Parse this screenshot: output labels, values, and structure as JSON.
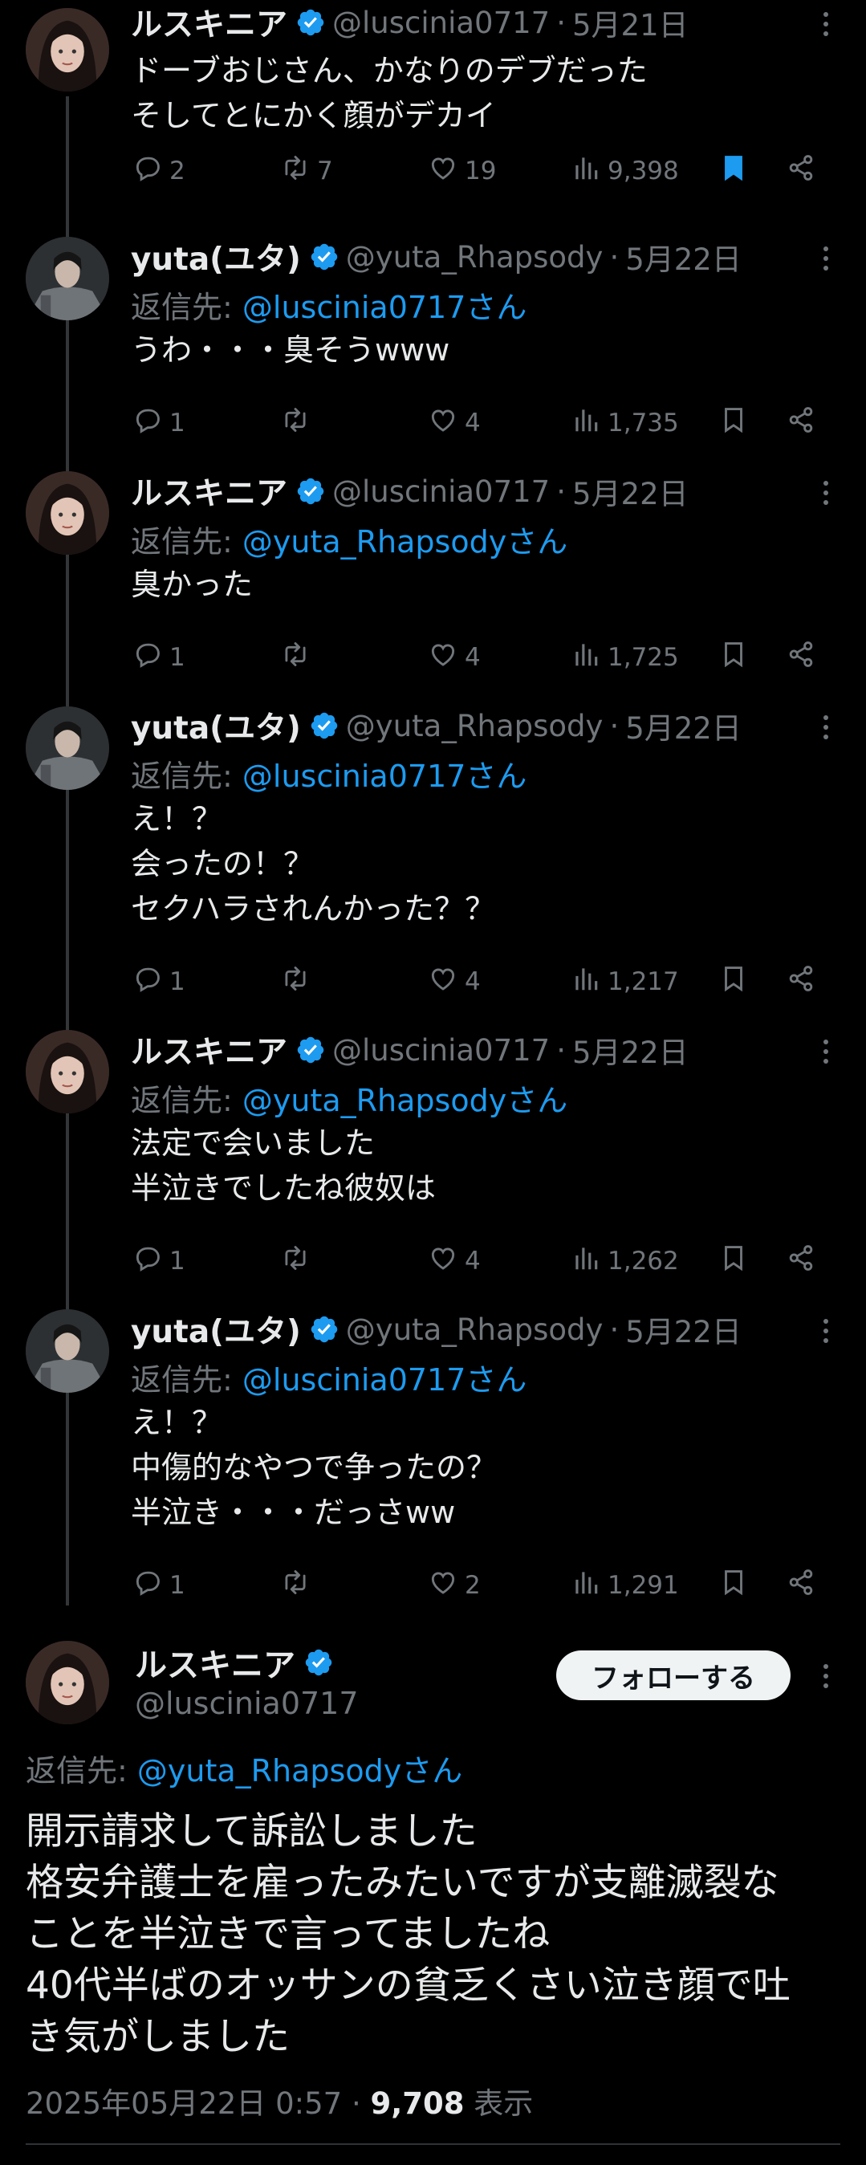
{
  "colors": {
    "accent": "#1d9bf0",
    "muted": "#71767b",
    "text": "#e7e9ea",
    "background": "#000000"
  },
  "tweets": [
    {
      "author": "ルスキニア",
      "handle": "@luscinia0717",
      "sep": "·",
      "date": "5月21日",
      "reply_prefix": "",
      "reply_mention": "",
      "lines": [
        "ドーブおじさん、かなりのデブだった",
        "そしてとにかく顔がデカイ"
      ],
      "replies": "2",
      "retweets": "7",
      "likes": "19",
      "views": "9,398",
      "bookmarked": true
    },
    {
      "author": "yuta(ユタ)",
      "handle": "@yuta_Rhapsody",
      "sep": "·",
      "date": "5月22日",
      "reply_prefix": "返信先: ",
      "reply_mention": "@luscinia0717さん",
      "lines": [
        "うわ・・・臭そうwww"
      ],
      "replies": "1",
      "retweets": "",
      "likes": "4",
      "views": "1,735",
      "bookmarked": false
    },
    {
      "author": "ルスキニア",
      "handle": "@luscinia0717",
      "sep": "·",
      "date": "5月22日",
      "reply_prefix": "返信先: ",
      "reply_mention": "@yuta_Rhapsodyさん",
      "lines": [
        "臭かった"
      ],
      "replies": "1",
      "retweets": "",
      "likes": "4",
      "views": "1,725",
      "bookmarked": false
    },
    {
      "author": "yuta(ユタ)",
      "handle": "@yuta_Rhapsody",
      "sep": "·",
      "date": "5月22日",
      "reply_prefix": "返信先: ",
      "reply_mention": "@luscinia0717さん",
      "lines": [
        "え！？",
        "会ったの！？",
        "セクハラされんかった？？"
      ],
      "replies": "1",
      "retweets": "",
      "likes": "4",
      "views": "1,217",
      "bookmarked": false
    },
    {
      "author": "ルスキニア",
      "handle": "@luscinia0717",
      "sep": "·",
      "date": "5月22日",
      "reply_prefix": "返信先: ",
      "reply_mention": "@yuta_Rhapsodyさん",
      "lines": [
        "法定で会いました",
        "半泣きでしたね彼奴は"
      ],
      "replies": "1",
      "retweets": "",
      "likes": "4",
      "views": "1,262",
      "bookmarked": false
    },
    {
      "author": "yuta(ユタ)",
      "handle": "@yuta_Rhapsody",
      "sep": "·",
      "date": "5月22日",
      "reply_prefix": "返信先: ",
      "reply_mention": "@luscinia0717さん",
      "lines": [
        "え！？",
        "中傷的なやつで争ったの？",
        "半泣き・・・だっさww"
      ],
      "replies": "1",
      "retweets": "",
      "likes": "2",
      "views": "1,291",
      "bookmarked": false
    }
  ],
  "main": {
    "author": "ルスキニア",
    "handle": "@luscinia0717",
    "follow_label": "フォローする",
    "reply_prefix": "返信先: ",
    "reply_mention": "@yuta_Rhapsodyさん",
    "lines": [
      "開示請求して訴訟しました",
      "格安弁護士を雇ったみたいですが支離滅裂な",
      "ことを半泣きで言ってましたね",
      "40代半ばのオッサンの貧乏くさい泣き顔で吐",
      "き気がしました"
    ],
    "timestamp": "2025年05月22日 0:57",
    "sep": " · ",
    "views": "9,708",
    "views_label": " 表示"
  },
  "icons": [
    "reply-icon",
    "retweet-icon",
    "like-icon",
    "views-icon",
    "bookmark-icon",
    "share-icon",
    "more-icon",
    "verified-icon"
  ]
}
